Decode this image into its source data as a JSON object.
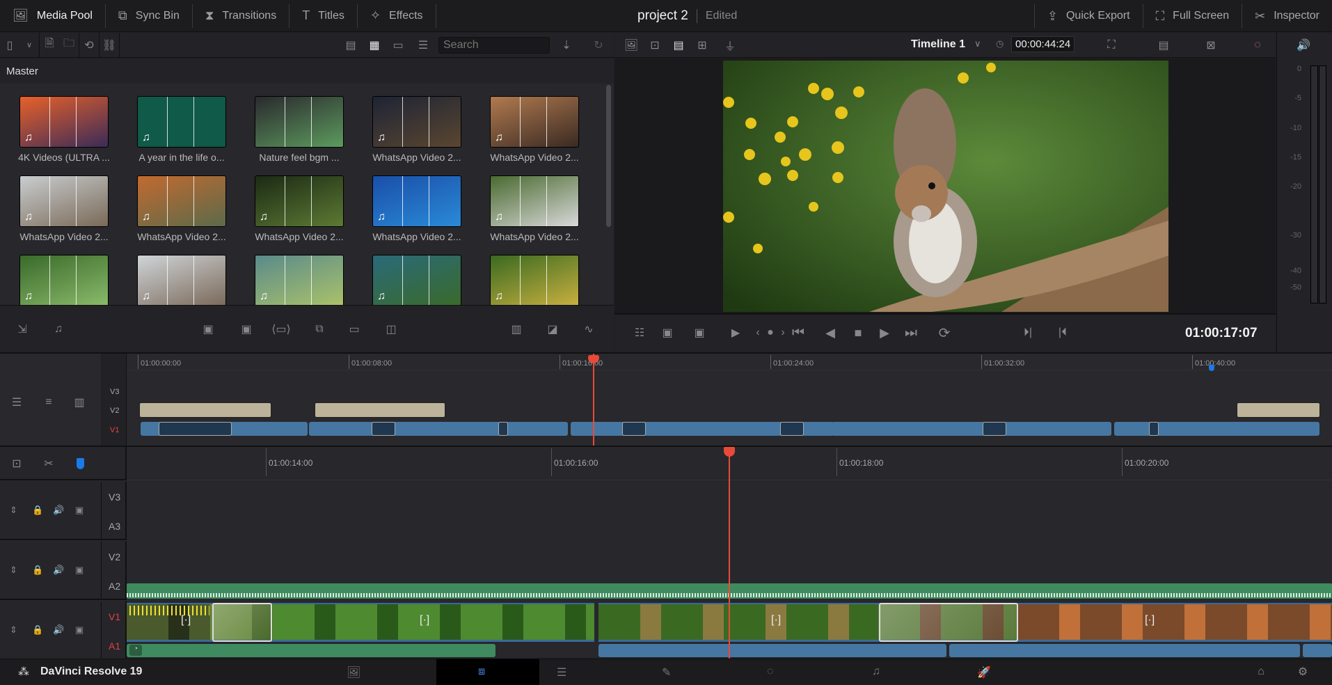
{
  "topbar": {
    "tabs": [
      {
        "label": "Media Pool",
        "icon": "media-pool-icon",
        "active": true
      },
      {
        "label": "Sync Bin",
        "icon": "sync-bin-icon"
      },
      {
        "label": "Transitions",
        "icon": "transitions-icon"
      },
      {
        "label": "Titles",
        "icon": "titles-icon"
      },
      {
        "label": "Effects",
        "icon": "effects-icon"
      }
    ],
    "project": "project 2",
    "status": "Edited",
    "right": [
      {
        "label": "Quick Export",
        "icon": "export-icon"
      },
      {
        "label": "Full Screen",
        "icon": "fullscreen-icon"
      },
      {
        "label": "Inspector",
        "icon": "inspector-icon"
      }
    ]
  },
  "pool": {
    "search_placeholder": "Search",
    "bin": "Master",
    "clips": [
      {
        "label": "4K Videos (ULTRA ...",
        "c1": "#e8612a",
        "c2": "#3a2b58"
      },
      {
        "label": "A year in the life o...",
        "c1": "#0f5a48",
        "c2": "#0f5a48"
      },
      {
        "label": "Nature feel bgm  ...",
        "c1": "#2a2a2e",
        "c2": "#5d9a5e"
      },
      {
        "label": "WhatsApp Video 2...",
        "c1": "#1e2435",
        "c2": "#5a4630"
      },
      {
        "label": "WhatsApp Video 2...",
        "c1": "#b07a50",
        "c2": "#3a2a22"
      },
      {
        "label": "WhatsApp Video 2...",
        "c1": "#c9cdd0",
        "c2": "#7a6a58"
      },
      {
        "label": "WhatsApp Video 2...",
        "c1": "#c26a30",
        "c2": "#5c6a4a"
      },
      {
        "label": "WhatsApp Video 2...",
        "c1": "#1c2a14",
        "c2": "#5c7a34"
      },
      {
        "label": "WhatsApp Video 2...",
        "c1": "#1a4fa8",
        "c2": "#2a8ad8"
      },
      {
        "label": "WhatsApp Video 2...",
        "c1": "#4a6a30",
        "c2": "#d8d8d8"
      },
      {
        "label": "",
        "c1": "#3a6a2a",
        "c2": "#8aba6a"
      },
      {
        "label": "",
        "c1": "#d0d4d8",
        "c2": "#7a6a5a"
      },
      {
        "label": "",
        "c1": "#5a8a8a",
        "c2": "#aac26a"
      },
      {
        "label": "",
        "c1": "#2a6a7a",
        "c2": "#3a6a2a"
      },
      {
        "label": "",
        "c1": "#3a6a20",
        "c2": "#c8b040"
      }
    ]
  },
  "viewer": {
    "timeline": "Timeline 1",
    "duration": "00:00:44:24",
    "timecode": "01:00:17:07"
  },
  "meters": {
    "ticks": [
      "0",
      "-5",
      "-10",
      "-15",
      "-20",
      "-30",
      "-40",
      "-50"
    ]
  },
  "mini": {
    "ruler": [
      "01:00:00:00",
      "01:00:08:00",
      "01:00:16:00",
      "01:00:24:00",
      "01:00:32:00",
      "01:00:40:00"
    ],
    "tracks": [
      "V3",
      "V2",
      "V1"
    ]
  },
  "timeline": {
    "ruler": [
      "01:00:14:00",
      "01:00:16:00",
      "01:00:18:00",
      "01:00:20:00"
    ],
    "tracks": [
      {
        "v": "V3",
        "a": "A3"
      },
      {
        "v": "V2",
        "a": "A2"
      },
      {
        "v": "V1",
        "a": "A1"
      }
    ]
  },
  "footer": {
    "app": "DaVinci Resolve 19",
    "pages": [
      "media",
      "cut",
      "edit",
      "fusion",
      "color",
      "fairlight",
      "deliver"
    ]
  }
}
